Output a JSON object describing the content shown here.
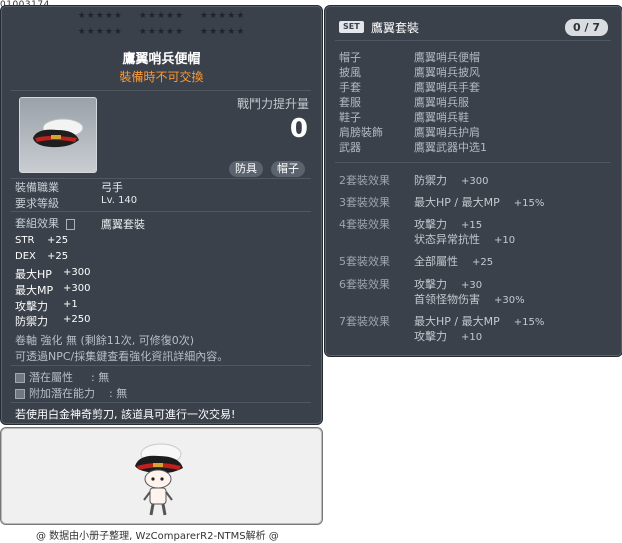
{
  "item_id": "01003174",
  "stars": [
    "★★★★★",
    "★★★★★",
    "★★★★★"
  ],
  "item": {
    "name": "鷹翼哨兵便帽",
    "trade_note": "裝備時不可交換",
    "power_label": "戰鬥力提升量",
    "power_value": "0",
    "tags": [
      "防具",
      "帽子"
    ],
    "job_label": "裝備職業",
    "job_value": "弓手",
    "level_label": "要求等級",
    "level_value": "Lv. 140",
    "set_label": "套組效果",
    "set_value": "鷹翼套裝",
    "stats": [
      {
        "name": "STR",
        "value": "+25"
      },
      {
        "name": "DEX",
        "value": "+25"
      },
      {
        "name": "最大HP",
        "value": "+300"
      },
      {
        "name": "最大MP",
        "value": "+300"
      },
      {
        "name": "攻擊力",
        "value": "+1"
      },
      {
        "name": "防禦力",
        "value": "+250"
      }
    ],
    "scroll_line": "卷軸 強化 無 (剩餘11次, 可修復0次)",
    "hint_line": "可透過NPC/採集鍵查看強化資訊詳細內容。",
    "potential_label": "潛在屬性",
    "potential_value": "無",
    "add_potential_label": "附加潛在能力",
    "add_potential_value": "無",
    "scissors_note": "若使用白金神奇剪刀, 該道具可進行一次交易!"
  },
  "set": {
    "badge": "SET",
    "name": "鷹翼套裝",
    "count": "0 / 7",
    "pieces": [
      {
        "slot": "帽子",
        "item": "鷹翼哨兵便帽"
      },
      {
        "slot": "披風",
        "item": "鷹翼哨兵披风"
      },
      {
        "slot": "手套",
        "item": "鷹翼哨兵手套"
      },
      {
        "slot": "套服",
        "item": "鷹翼哨兵服"
      },
      {
        "slot": "鞋子",
        "item": "鷹翼哨兵鞋"
      },
      {
        "slot": "肩膀裝飾",
        "item": "鷹翼哨兵护肩"
      },
      {
        "slot": "武器",
        "item": "鷹翼武器中选1"
      }
    ],
    "effects": [
      {
        "label": "2套裝效果",
        "lines": [
          [
            "防禦力",
            "+300"
          ]
        ]
      },
      {
        "label": "3套裝效果",
        "lines": [
          [
            "最大HP / 最大MP",
            "+15%"
          ]
        ]
      },
      {
        "label": "4套裝效果",
        "lines": [
          [
            "攻擊力",
            "+15"
          ],
          [
            "状态异常抗性",
            "+10"
          ]
        ]
      },
      {
        "label": "5套裝效果",
        "lines": [
          [
            "全部屬性",
            "+25"
          ]
        ]
      },
      {
        "label": "6套裝效果",
        "lines": [
          [
            "攻擊力",
            "+30"
          ],
          [
            "首领怪物伤害",
            "+30%"
          ]
        ]
      },
      {
        "label": "7套裝效果",
        "lines": [
          [
            "最大HP / 最大MP",
            "+15%"
          ],
          [
            "攻擊力",
            "+10"
          ]
        ]
      }
    ]
  },
  "footer": "@ 数据由小册子整理, WzComparerR2-NTMS解析 @",
  "colors": {
    "panel": "#3a414b",
    "accent_orange": "#ff9933",
    "preview_bg": "#f0f0f0"
  }
}
